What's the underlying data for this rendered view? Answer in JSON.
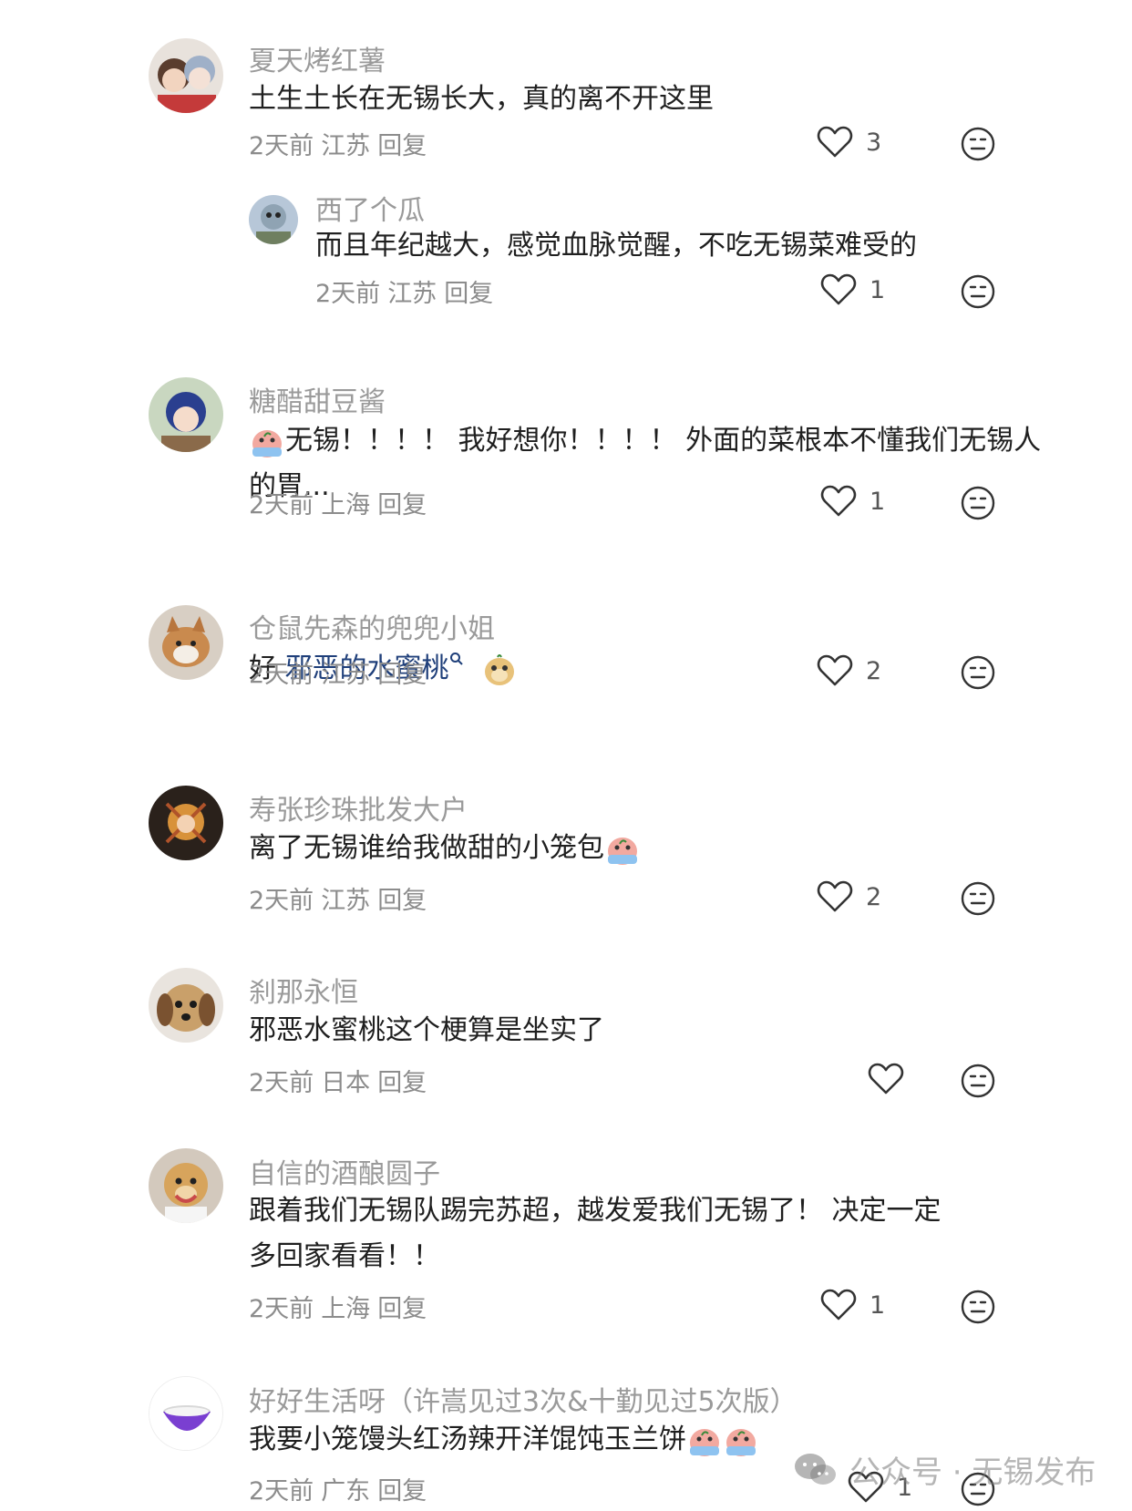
{
  "comments": [
    {
      "name": "夏天烤红薯",
      "text": "土生土长在无锡长大，真的离不开这里",
      "time": "2天前",
      "location": "江苏",
      "reply": "回复",
      "likes": "3"
    },
    {
      "name": "西了个瓜",
      "text": "而且年纪越大，感觉血脉觉醒，不吃无锡菜难受的",
      "time": "2天前",
      "location": "江苏",
      "reply": "回复",
      "likes": "1"
    },
    {
      "name": "糖醋甜豆酱",
      "text_a": "无锡！！！！ 我好想你！！！！ 外面的菜根本不懂我们无锡人",
      "text_b": "的胃...",
      "time": "2天前",
      "location": "上海",
      "reply": "回复",
      "likes": "1"
    },
    {
      "name": "仓鼠先森的兜兜小姐",
      "text_prefix": "好 ",
      "keyword": "邪恶的水蜜桃",
      "time": "2天前",
      "location": "江苏",
      "reply": "回复",
      "likes": "2"
    },
    {
      "name": "寿张珍珠批发大户",
      "text": "离了无锡谁给我做甜的小笼包",
      "time": "2天前",
      "location": "江苏",
      "reply": "回复",
      "likes": "2"
    },
    {
      "name": "刹那永恒",
      "text": "邪恶水蜜桃这个梗算是坐实了",
      "time": "2天前",
      "location": "日本",
      "reply": "回复",
      "likes": ""
    },
    {
      "name": "自信的酒酿圆子",
      "text_a": "跟着我们无锡队踢完苏超，越发爱我们无锡了！ 决定一定",
      "text_b": "多回家看看！！",
      "time": "2天前",
      "location": "上海",
      "reply": "回复",
      "likes": "1"
    },
    {
      "name": "好好生活呀（许嵩见过3次&十勤见过5次版）",
      "text": "我要小笼馒头红汤辣开洋馄饨玉兰饼",
      "time": "2天前",
      "location": "广东",
      "reply": "回复",
      "likes": "1"
    }
  ],
  "icons": {
    "like": "heart-outline-icon",
    "dislike": "neutral-face-icon",
    "search": "search-icon",
    "crying": "crying-emoji-icon"
  },
  "watermark": {
    "text": "公众号 · 无锡发布",
    "icon": "wechat-icon"
  }
}
